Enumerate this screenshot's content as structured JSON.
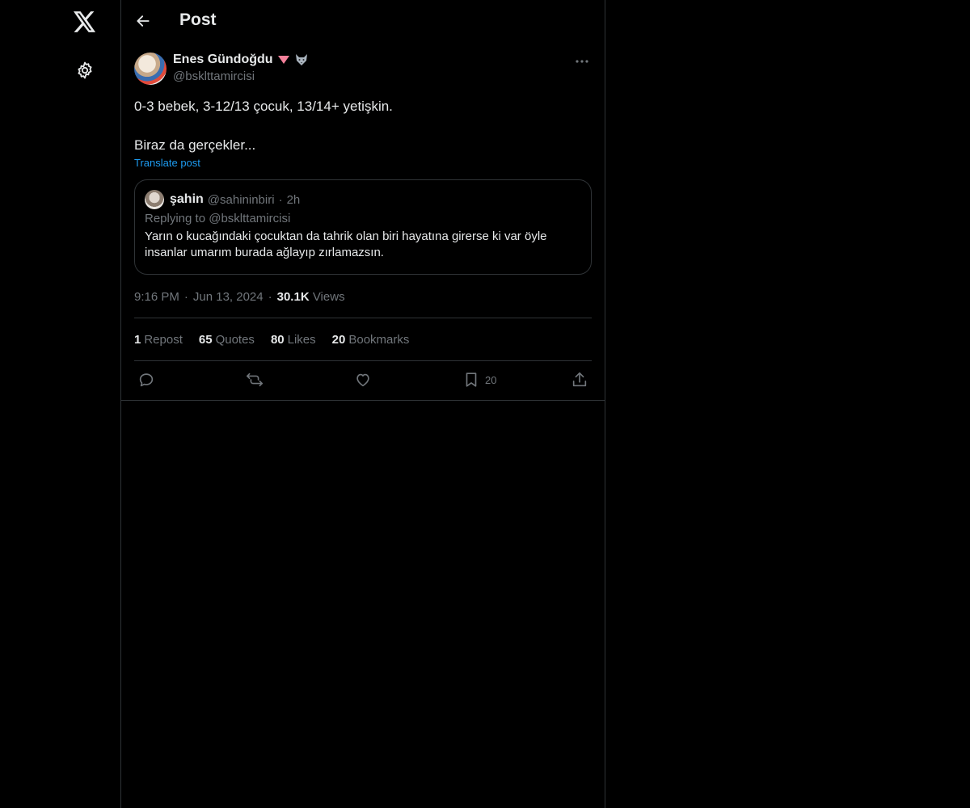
{
  "header": {
    "title": "Post"
  },
  "left_rail": {
    "logo_icon": "x-logo-icon",
    "settings_icon": "gear-icon"
  },
  "post": {
    "author_name": "Enes Gündoğdu",
    "author_handle": "@bsklttamircisi",
    "text": "0-3 bebek, 3-12/13 çocuk, 13/14+ yetişkin.\n\nBiraz da gerçekler...",
    "translate_label": "Translate post",
    "time": "9:16 PM",
    "date": "Jun 13, 2024",
    "views_count": "30.1K",
    "views_label": "Views"
  },
  "quote": {
    "name": "şahin",
    "handle": "@sahininbiri",
    "separator": "·",
    "time": "2h",
    "replying": "Replying to @bsklttamircisi",
    "text": "Yarın o kucağındaki çocuktan da tahrik olan biri hayatına girerse ki var öyle insanlar umarım burada ağlayıp zırlamazsın."
  },
  "stats": {
    "reposts_count": "1",
    "reposts_label": "Repost",
    "quotes_count": "65",
    "quotes_label": "Quotes",
    "likes_count": "80",
    "likes_label": "Likes",
    "bookmarks_count": "20",
    "bookmarks_label": "Bookmarks"
  },
  "actions": {
    "bookmark_count": "20"
  },
  "colors": {
    "background": "#000000",
    "text_primary": "#e7e9ea",
    "text_secondary": "#71767b",
    "border": "#2f3336",
    "link": "#1d9bf0"
  }
}
